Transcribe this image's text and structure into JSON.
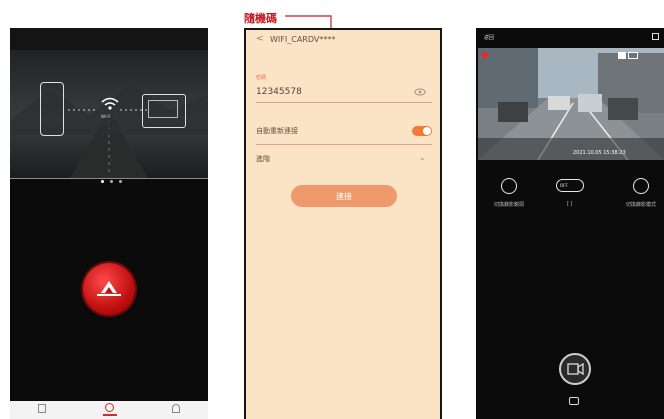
{
  "annotation": {
    "label": "隨機碼",
    "color": "#c81a24"
  },
  "phone1": {
    "wifi_text": "Wi-Fi"
  },
  "phone2": {
    "ssid": "WIFI_CARDV****",
    "password_label": "密碼",
    "password_value": "12345578",
    "auto_connect_label": "自動重新連接",
    "advanced_label": "進階",
    "connect_button": "連接",
    "accent_color": "#f07b3b"
  },
  "phone3": {
    "top_left": "返回",
    "timestamp": "2021.10.05  15:38:23",
    "control_labels": [
      "切換錄影鏡頭",
      "OFF",
      "切換錄影模式"
    ],
    "off_caption": "[ ]"
  }
}
